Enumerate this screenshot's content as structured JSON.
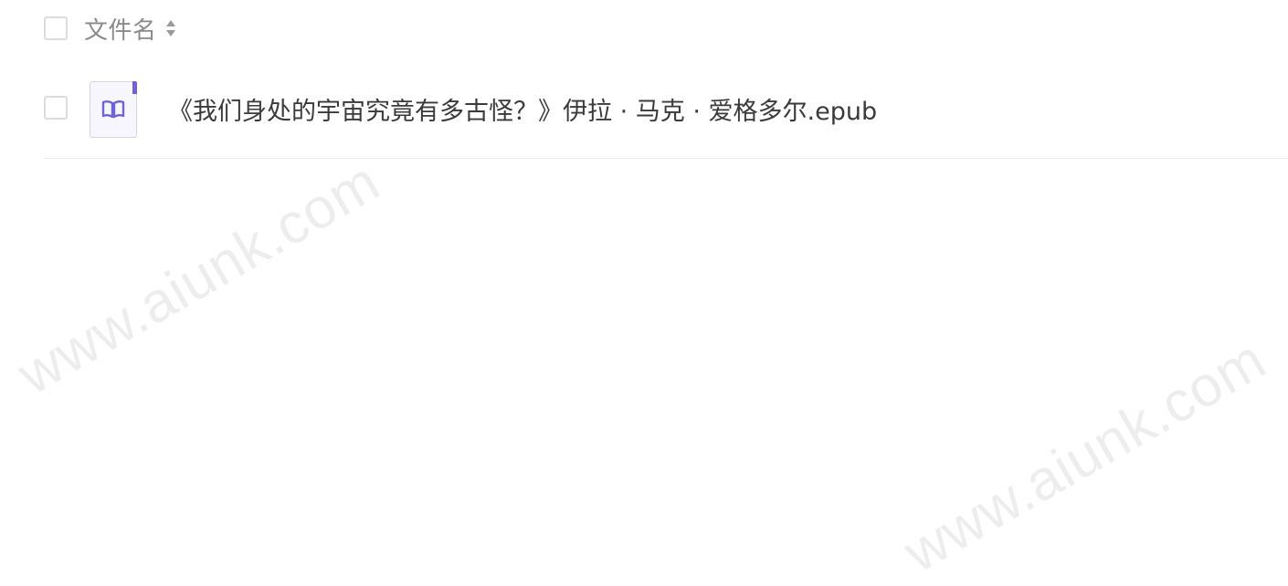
{
  "header": {
    "column_label": "文件名"
  },
  "files": [
    {
      "name": "《我们身处的宇宙究竟有多古怪？》伊拉 · 马克 · 爱格多尔.epub",
      "icon": "book-icon"
    }
  ],
  "watermark": {
    "text": "www.aiunk.com"
  },
  "colors": {
    "accent": "#6f63d6",
    "label": "#8a8a8a",
    "text": "#3a3a3a"
  }
}
